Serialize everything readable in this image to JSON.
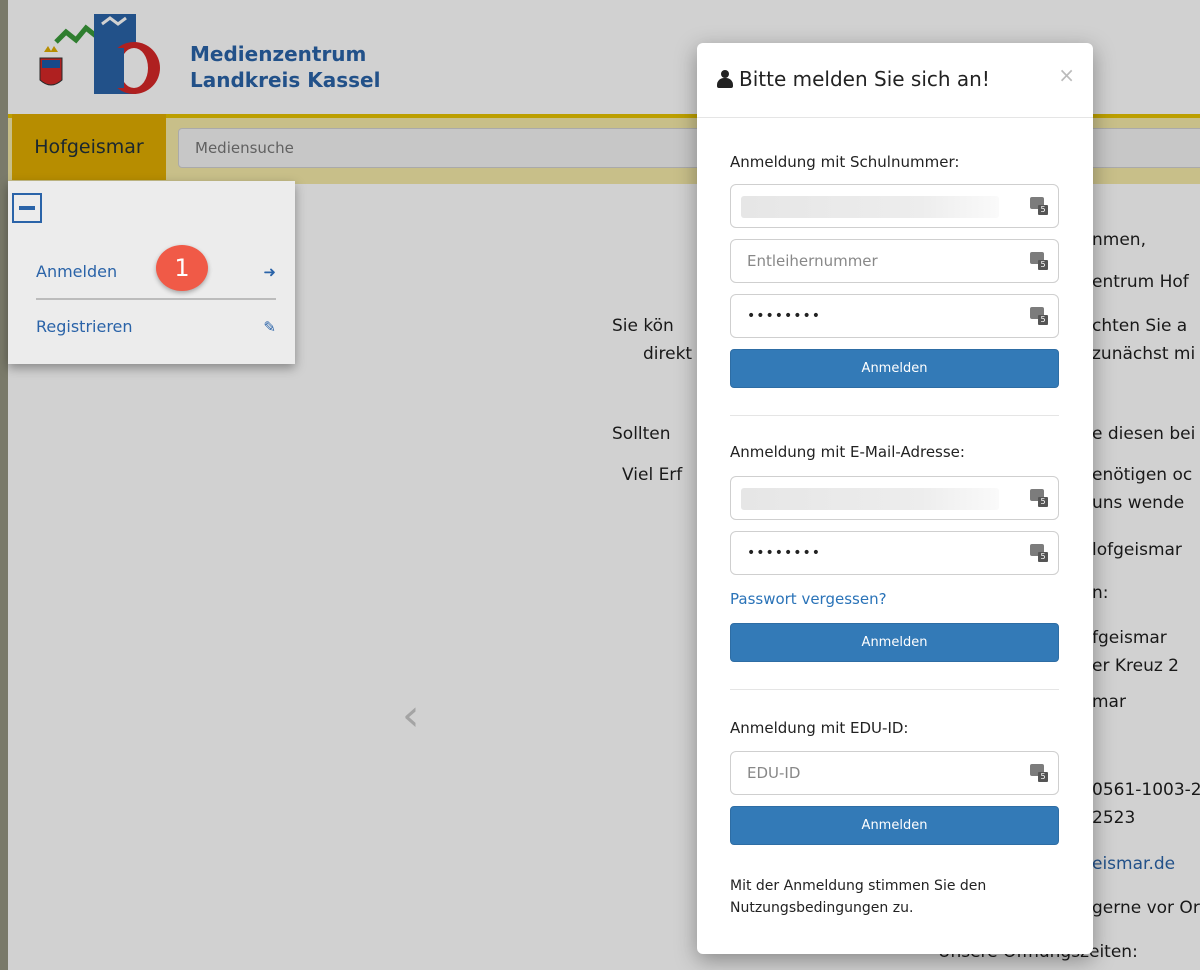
{
  "header": {
    "brand_line1": "Medienzentrum",
    "brand_line2": "Landkreis Kassel"
  },
  "navbar": {
    "location": "Hofgeismar",
    "search_placeholder": "Mediensuche"
  },
  "menu": {
    "items": [
      {
        "label": "Anmelden",
        "icon": "sign-in-icon"
      },
      {
        "label": "Registrieren",
        "icon": "edit-icon"
      }
    ],
    "step_badge": "1"
  },
  "background_text": {
    "left": [
      "Sie kön",
      "direkt",
      "Sollten",
      "Viel Erf"
    ],
    "right": [
      "nmen,",
      "entrum Hof",
      "chten Sie a",
      "zunächst mi",
      "e diesen bei",
      "enötigen oc",
      "uns wende",
      "lofgeismar",
      "n:",
      "fgeismar",
      "er Kreuz 2",
      "mar",
      "0561-1003-2",
      "2523",
      "eismar.de",
      "gerne vor Or",
      "Unsere Öffnungszeiten:"
    ]
  },
  "modal": {
    "title": "Bitte melden Sie sich an!",
    "close_label": "×",
    "school_section": {
      "label": "Anmeldung mit Schulnummer:",
      "school_number_value": "",
      "borrower_placeholder": "Entleihernummer",
      "password_mask": "••••••••",
      "submit_label": "Anmelden"
    },
    "email_section": {
      "label": "Anmeldung mit E-Mail-Adresse:",
      "email_value": "",
      "password_mask": "••••••••",
      "forgot_label": "Passwort vergessen?",
      "submit_label": "Anmelden"
    },
    "edu_section": {
      "label": "Anmeldung mit EDU-ID:",
      "edu_placeholder": "EDU-ID",
      "submit_label": "Anmelden"
    },
    "terms_text": "Mit der Anmeldung stimmen Sie den Nutzungsbedingungen zu."
  },
  "colors": {
    "brand_blue": "#2a63a8",
    "nav_yellow": "#e0ad00",
    "button_blue": "#337ab7",
    "badge_red": "#f05a47"
  }
}
